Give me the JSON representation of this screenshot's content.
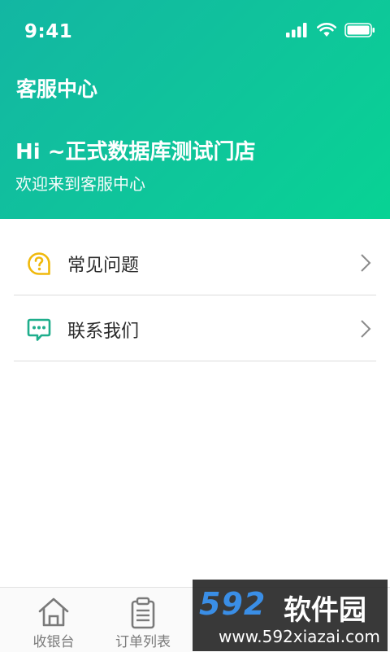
{
  "status_bar": {
    "time": "9:41",
    "icons": [
      "signal-icon",
      "wifi-icon",
      "battery-icon"
    ]
  },
  "header": {
    "title": "客服中心",
    "greeting": "Hi ~正式数据库测试门店",
    "subtitle": "欢迎来到客服中心"
  },
  "menu": {
    "items": [
      {
        "label": "常见问题",
        "icon": "question-bubble-icon",
        "icon_color": "#f0b90b"
      },
      {
        "label": "联系我们",
        "icon": "message-bubble-icon",
        "icon_color": "#1fae8c"
      }
    ]
  },
  "tabbar": {
    "tabs": [
      {
        "label": "收银台",
        "icon": "home-icon"
      },
      {
        "label": "订单列表",
        "icon": "clipboard-icon"
      }
    ]
  },
  "watermark": {
    "logo": "592",
    "name": "软件园",
    "url": "www.592xiazai.com"
  },
  "colors": {
    "header_gradient_start": "#13b6a3",
    "header_gradient_end": "#08d394",
    "accent": "#10c29c"
  }
}
